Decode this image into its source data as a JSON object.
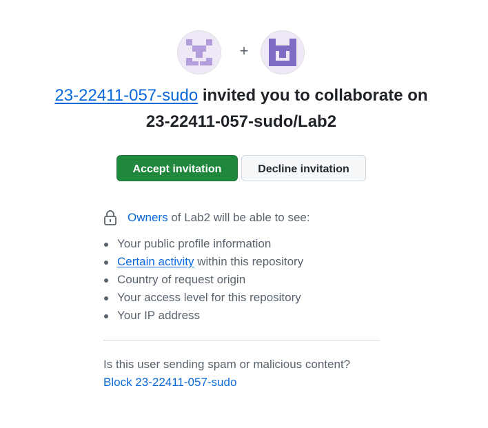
{
  "inviter": {
    "username": "23-22411-057-sudo",
    "avatar_icon": "identicon-avatar",
    "avatar_color": "#b39ddb"
  },
  "repo": {
    "avatar_icon": "identicon-avatar",
    "avatar_color": "#7e6bc4"
  },
  "plus_symbol": "+",
  "headline": {
    "invite_text": "invited you to collaborate on",
    "repo_full_name": "23-22411-057-sudo/Lab2"
  },
  "actions": {
    "accept_label": "Accept invitation",
    "decline_label": "Decline invitation"
  },
  "visibility": {
    "lock_icon": "lock-icon",
    "owners_link": "Owners",
    "owners_suffix": "of Lab2 will be able to see:",
    "items": [
      {
        "text": "Your public profile information"
      },
      {
        "link": "Certain activity",
        "text": "within this repository"
      },
      {
        "text": "Country of request origin"
      },
      {
        "text": "Your access level for this repository"
      },
      {
        "text": "Your IP address"
      }
    ]
  },
  "spam": {
    "question": "Is this user sending spam or malicious content?",
    "block_label": "Block 23-22411-057-sudo"
  },
  "colors": {
    "accept_bg": "#1f883d",
    "link": "#0969da",
    "muted_text": "#59636e"
  }
}
